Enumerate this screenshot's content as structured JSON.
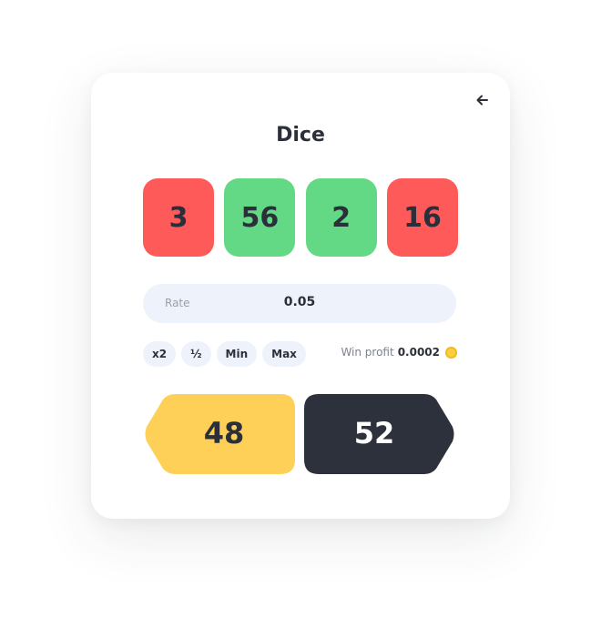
{
  "header": {
    "title": "Dice",
    "back_icon": "arrow-left-icon"
  },
  "dice": [
    {
      "value": "3",
      "color": "#ff5a5a"
    },
    {
      "value": "56",
      "color": "#64d985"
    },
    {
      "value": "2",
      "color": "#64d985"
    },
    {
      "value": "16",
      "color": "#ff5a5a"
    }
  ],
  "rate": {
    "label": "Rate",
    "value": "0.05"
  },
  "chips": [
    "x2",
    "½",
    "Min",
    "Max"
  ],
  "win_profit": {
    "label": "Win profit",
    "amount": "0.0002",
    "icon": "coin-icon"
  },
  "bets": {
    "low": {
      "label": "48",
      "color": "#ffd057"
    },
    "high": {
      "label": "52",
      "color": "#2d313c"
    }
  }
}
